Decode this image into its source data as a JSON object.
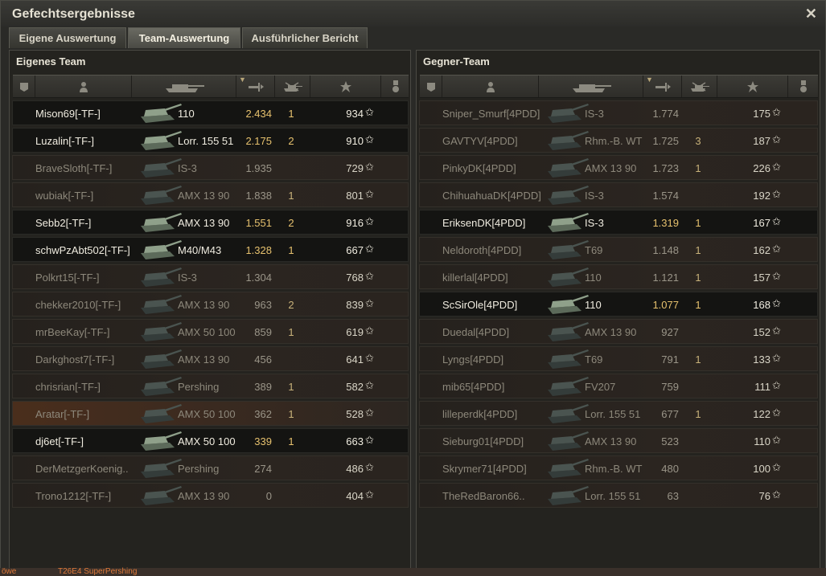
{
  "window": {
    "title": "Gefechtsergebnisse"
  },
  "tabs": [
    {
      "label": "Eigene Auswertung",
      "active": false
    },
    {
      "label": "Team-Auswertung",
      "active": true
    },
    {
      "label": "Ausführlicher Bericht",
      "active": false
    }
  ],
  "own_team": {
    "title": "Eigenes Team",
    "rows": [
      {
        "name": "Mison69[-TF-]",
        "tank": "110",
        "damage": "2.434",
        "kills": "1",
        "xp": "934",
        "alive": true
      },
      {
        "name": "Luzalin[-TF-]",
        "tank": "Lorr. 155 51",
        "damage": "2.175",
        "kills": "2",
        "xp": "910",
        "alive": true
      },
      {
        "name": "BraveSloth[-TF-]",
        "tank": "IS-3",
        "damage": "1.935",
        "kills": "",
        "xp": "729",
        "alive": false
      },
      {
        "name": "wubiak[-TF-]",
        "tank": "AMX 13 90",
        "damage": "1.838",
        "kills": "1",
        "xp": "801",
        "alive": false
      },
      {
        "name": "Sebb2[-TF-]",
        "tank": "AMX 13 90",
        "damage": "1.551",
        "kills": "2",
        "xp": "916",
        "alive": true
      },
      {
        "name": "schwPzAbt502[-TF-]",
        "tank": "M40/M43",
        "damage": "1.328",
        "kills": "1",
        "xp": "667",
        "alive": true
      },
      {
        "name": "Polkrt15[-TF-]",
        "tank": "IS-3",
        "damage": "1.304",
        "kills": "",
        "xp": "768",
        "alive": false
      },
      {
        "name": "chekker2010[-TF-]",
        "tank": "AMX 13 90",
        "damage": "963",
        "kills": "2",
        "xp": "839",
        "alive": false
      },
      {
        "name": "mrBeeKay[-TF-]",
        "tank": "AMX 50 100",
        "damage": "859",
        "kills": "1",
        "xp": "619",
        "alive": false
      },
      {
        "name": "Darkghost7[-TF-]",
        "tank": "AMX 13 90",
        "damage": "456",
        "kills": "",
        "xp": "641",
        "alive": false
      },
      {
        "name": "chrisrian[-TF-]",
        "tank": "Pershing",
        "damage": "389",
        "kills": "1",
        "xp": "582",
        "alive": false
      },
      {
        "name": "Aratar[-TF-]",
        "tank": "AMX 50 100",
        "damage": "362",
        "kills": "1",
        "xp": "528",
        "alive": false,
        "highlight": true
      },
      {
        "name": "dj6et[-TF-]",
        "tank": "AMX 50 100",
        "damage": "339",
        "kills": "1",
        "xp": "663",
        "alive": true
      },
      {
        "name": "DerMetzgerKoenig..",
        "tank": "Pershing",
        "damage": "274",
        "kills": "",
        "xp": "486",
        "alive": false
      },
      {
        "name": "Trono1212[-TF-]",
        "tank": "AMX 13 90",
        "damage": "0",
        "kills": "",
        "xp": "404",
        "alive": false
      }
    ]
  },
  "enemy_team": {
    "title": "Gegner-Team",
    "rows": [
      {
        "name": "Sniper_Smurf[4PDD]",
        "tank": "IS-3",
        "damage": "1.774",
        "kills": "",
        "xp": "175",
        "alive": false
      },
      {
        "name": "GAVTYV[4PDD]",
        "tank": "Rhm.-B. WT",
        "damage": "1.725",
        "kills": "3",
        "xp": "187",
        "alive": false
      },
      {
        "name": "PinkyDK[4PDD]",
        "tank": "AMX 13 90",
        "damage": "1.723",
        "kills": "1",
        "xp": "226",
        "alive": false
      },
      {
        "name": "ChihuahuaDK[4PDD]",
        "tank": "IS-3",
        "damage": "1.574",
        "kills": "",
        "xp": "192",
        "alive": false
      },
      {
        "name": "EriksenDK[4PDD]",
        "tank": "IS-3",
        "damage": "1.319",
        "kills": "1",
        "xp": "167",
        "alive": true
      },
      {
        "name": "Neldoroth[4PDD]",
        "tank": "T69",
        "damage": "1.148",
        "kills": "1",
        "xp": "162",
        "alive": false
      },
      {
        "name": "killerlal[4PDD]",
        "tank": "110",
        "damage": "1.121",
        "kills": "1",
        "xp": "157",
        "alive": false
      },
      {
        "name": "ScSirOle[4PDD]",
        "tank": "110",
        "damage": "1.077",
        "kills": "1",
        "xp": "168",
        "alive": true
      },
      {
        "name": "Duedal[4PDD]",
        "tank": "AMX 13 90",
        "damage": "927",
        "kills": "",
        "xp": "152",
        "alive": false
      },
      {
        "name": "Lyngs[4PDD]",
        "tank": "T69",
        "damage": "791",
        "kills": "1",
        "xp": "133",
        "alive": false
      },
      {
        "name": "mib65[4PDD]",
        "tank": "FV207",
        "damage": "759",
        "kills": "",
        "xp": "111",
        "alive": false
      },
      {
        "name": "lilleperdk[4PDD]",
        "tank": "Lorr. 155 51",
        "damage": "677",
        "kills": "1",
        "xp": "122",
        "alive": false
      },
      {
        "name": "Sieburg01[4PDD]",
        "tank": "AMX 13 90",
        "damage": "523",
        "kills": "",
        "xp": "110",
        "alive": false
      },
      {
        "name": "Skrymer71[4PDD]",
        "tank": "Rhm.-B. WT",
        "damage": "480",
        "kills": "",
        "xp": "100",
        "alive": false
      },
      {
        "name": "TheRedBaron66..",
        "tank": "Lorr. 155 51",
        "damage": "63",
        "kills": "",
        "xp": "76",
        "alive": false
      }
    ]
  },
  "bottom_strip": {
    "left": "öwe",
    "right": "T26E4 SuperPershing"
  },
  "icons": {
    "rank": "rank-chevron-icon",
    "player": "player-silhouette-icon",
    "tank": "tank-icon",
    "damage": "damage-icon",
    "kills": "destroyed-tank-icon",
    "xp": "star-icon",
    "medal": "medal-icon",
    "close": "close-icon"
  },
  "colors": {
    "damage_alive": "#e6c16e",
    "text_alive": "#f0ece0",
    "text_dead": "#8d887b"
  }
}
